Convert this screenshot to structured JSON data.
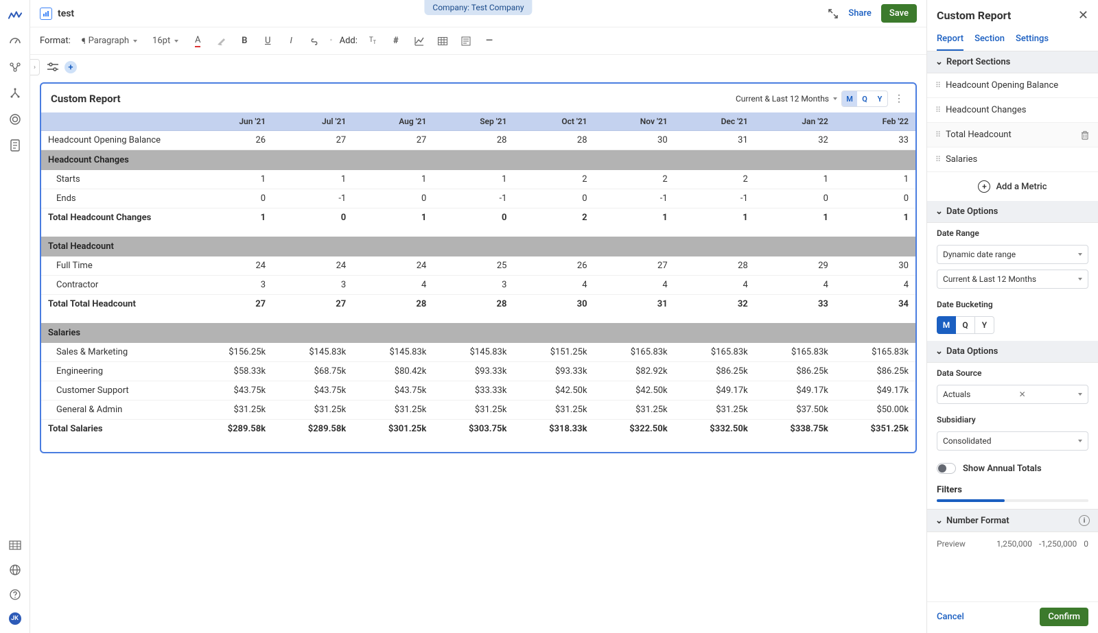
{
  "company_pill": "Company: Test Company",
  "doc_title": "test",
  "top": {
    "share": "Share",
    "save": "Save"
  },
  "toolbar": {
    "format_label": "Format:",
    "paragraph": "Paragraph",
    "font_size": "16pt",
    "add_label": "Add:"
  },
  "report": {
    "title": "Custom Report",
    "range": "Current & Last 12 Months",
    "buckets": [
      "M",
      "Q",
      "Y"
    ],
    "active_bucket": "M",
    "columns": [
      "Jun '21",
      "Jul '21",
      "Aug '21",
      "Sep '21",
      "Oct '21",
      "Nov '21",
      "Dec '21",
      "Jan '22",
      "Feb '22"
    ],
    "rows": [
      {
        "kind": "plain",
        "label": "Headcount Opening Balance",
        "vals": [
          "26",
          "27",
          "27",
          "28",
          "28",
          "30",
          "31",
          "32",
          "33"
        ]
      },
      {
        "kind": "section",
        "label": "Headcount Changes"
      },
      {
        "kind": "data",
        "label": "Starts",
        "vals": [
          "1",
          "1",
          "1",
          "1",
          "2",
          "2",
          "2",
          "1",
          "1"
        ]
      },
      {
        "kind": "data",
        "label": "Ends",
        "vals": [
          "0",
          "-1",
          "0",
          "-1",
          "0",
          "-1",
          "-1",
          "0",
          "0"
        ]
      },
      {
        "kind": "total",
        "label": "Total Headcount Changes",
        "vals": [
          "1",
          "0",
          "1",
          "0",
          "2",
          "1",
          "1",
          "1",
          "1"
        ]
      },
      {
        "kind": "spacer"
      },
      {
        "kind": "section",
        "label": "Total Headcount"
      },
      {
        "kind": "data",
        "label": "Full Time",
        "vals": [
          "24",
          "24",
          "24",
          "25",
          "26",
          "27",
          "28",
          "29",
          "30"
        ]
      },
      {
        "kind": "data",
        "label": "Contractor",
        "vals": [
          "3",
          "3",
          "4",
          "3",
          "4",
          "4",
          "4",
          "4",
          "4"
        ]
      },
      {
        "kind": "total",
        "label": "Total Total Headcount",
        "vals": [
          "27",
          "27",
          "28",
          "28",
          "30",
          "31",
          "32",
          "33",
          "34"
        ]
      },
      {
        "kind": "spacer"
      },
      {
        "kind": "section",
        "label": "Salaries"
      },
      {
        "kind": "data",
        "label": "Sales & Marketing",
        "vals": [
          "$156.25k",
          "$145.83k",
          "$145.83k",
          "$145.83k",
          "$151.25k",
          "$165.83k",
          "$165.83k",
          "$165.83k",
          "$165.83k"
        ]
      },
      {
        "kind": "data",
        "label": "Engineering",
        "vals": [
          "$58.33k",
          "$68.75k",
          "$80.42k",
          "$93.33k",
          "$93.33k",
          "$82.92k",
          "$86.25k",
          "$86.25k",
          "$86.25k"
        ]
      },
      {
        "kind": "data",
        "label": "Customer Support",
        "vals": [
          "$43.75k",
          "$43.75k",
          "$43.75k",
          "$33.33k",
          "$42.50k",
          "$42.50k",
          "$49.17k",
          "$49.17k",
          "$49.17k"
        ]
      },
      {
        "kind": "data",
        "label": "General & Admin",
        "vals": [
          "$31.25k",
          "$31.25k",
          "$31.25k",
          "$31.25k",
          "$31.25k",
          "$31.25k",
          "$31.25k",
          "$37.50k",
          "$50.00k"
        ]
      },
      {
        "kind": "total",
        "label": "Total Salaries",
        "vals": [
          "$289.58k",
          "$289.58k",
          "$301.25k",
          "$303.75k",
          "$318.33k",
          "$322.50k",
          "$332.50k",
          "$338.75k",
          "$351.25k"
        ]
      }
    ]
  },
  "panel": {
    "title": "Custom Report",
    "tabs": [
      "Report",
      "Section",
      "Settings"
    ],
    "sections_head": "Report Sections",
    "metrics": [
      "Headcount Opening Balance",
      "Headcount Changes",
      "Total Headcount",
      "Salaries"
    ],
    "hover_index": 2,
    "add_metric": "Add a Metric",
    "date_options": "Date Options",
    "date_range_label": "Date Range",
    "date_range_type": "Dynamic date range",
    "date_range_value": "Current & Last 12 Months",
    "bucketing_label": "Date Bucketing",
    "buckets": [
      "M",
      "Q",
      "Y"
    ],
    "data_options": "Data Options",
    "data_source_label": "Data Source",
    "data_source_value": "Actuals",
    "subsidiary_label": "Subsidiary",
    "subsidiary_value": "Consolidated",
    "annual_toggle": "Show Annual Totals",
    "filters": "Filters",
    "number_format": "Number Format",
    "preview_label": "Preview",
    "preview_vals": [
      "1,250,000",
      "-1,250,000",
      "0"
    ],
    "cancel": "Cancel",
    "confirm": "Confirm"
  }
}
